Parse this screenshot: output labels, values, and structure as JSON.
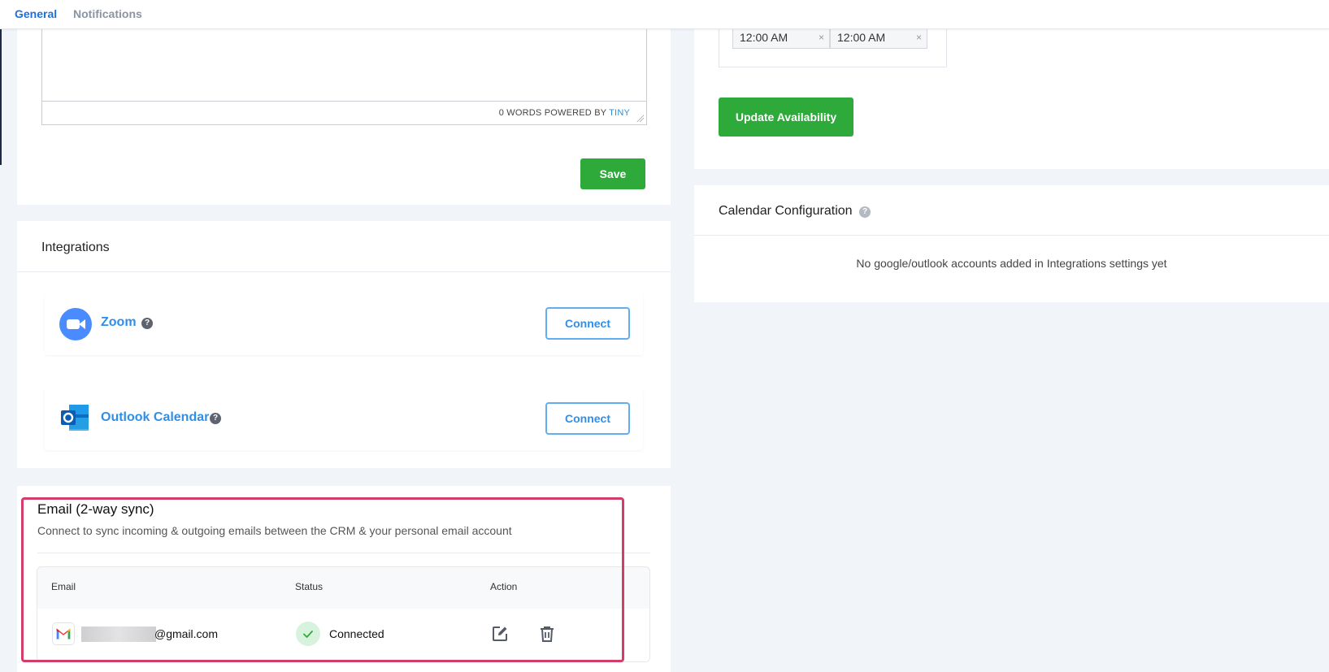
{
  "tabs": [
    {
      "label": "General",
      "active": true
    },
    {
      "label": "Notifications",
      "active": false
    }
  ],
  "editor": {
    "status_prefix": "0 WORDS POWERED BY ",
    "brand": "TINY"
  },
  "save_label": "Save",
  "integrations": {
    "title": "Integrations",
    "items": [
      {
        "name": "Zoom",
        "icon": "zoom-logo-icon",
        "action": "Connect"
      },
      {
        "name": "Outlook Calendar",
        "icon": "outlook-logo-icon",
        "action": "Connect"
      }
    ]
  },
  "email_sync": {
    "title": "Email (2-way sync)",
    "subtitle": "Connect to sync incoming & outgoing emails between the CRM & your personal email account",
    "columns": [
      "Email",
      "Status",
      "Action"
    ],
    "rows": [
      {
        "email_suffix": "@gmail.com",
        "status": "Connected"
      }
    ]
  },
  "availability": {
    "times": [
      "12:00 AM",
      "12:00 AM"
    ],
    "update_label": "Update Availability"
  },
  "calendar_config": {
    "title": "Calendar Configuration",
    "empty_message": "No google/outlook accounts added in Integrations settings yet"
  },
  "colors": {
    "accent_blue": "#2f8fe8",
    "green": "#2eaa3a",
    "highlight": "#d23d6a"
  }
}
